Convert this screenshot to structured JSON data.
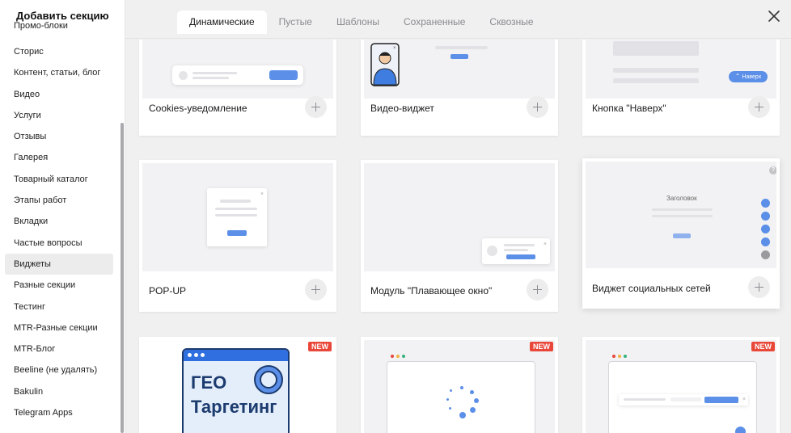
{
  "sidebar": {
    "title": "Добавить секцию",
    "cut_item": "Промо-блоки",
    "items": [
      "Сторис",
      "Контент, статьи, блог",
      "Видео",
      "Услуги",
      "Отзывы",
      "Галерея",
      "Товарный каталог",
      "Этапы работ",
      "Вкладки",
      "Частые вопросы",
      "Виджеты",
      "Разные секции",
      "Тестинг",
      "MTR-Разные секции",
      "MTR-Блог",
      "Beeline (не удалять)",
      "Bakulin",
      "Telegram Apps"
    ],
    "active_item": "Виджеты"
  },
  "tabs": [
    "Динамические",
    "Пустые",
    "Шаблоны",
    "Сохраненные",
    "Сквозные"
  ],
  "active_tab": "Динамические",
  "cards": {
    "cookies": "Cookies-уведомление",
    "video_widget": "Видео-виджет",
    "up_button": "Кнопка \"Наверх\"",
    "popup": "POP-UP",
    "floating": "Модуль \"Плавающее окно\"",
    "social": "Виджет социальных сетей"
  },
  "previews": {
    "up_button_label": "Наверх",
    "social_heading": "Заголовок",
    "geo_line1": "ГЕО",
    "geo_line2": "Таргетинг",
    "help_mark": "?"
  },
  "badge": "NEW",
  "colors": {
    "accent_blue": "#5b8fe8",
    "badge_red": "#e9473a",
    "active_bg": "#ececec"
  }
}
